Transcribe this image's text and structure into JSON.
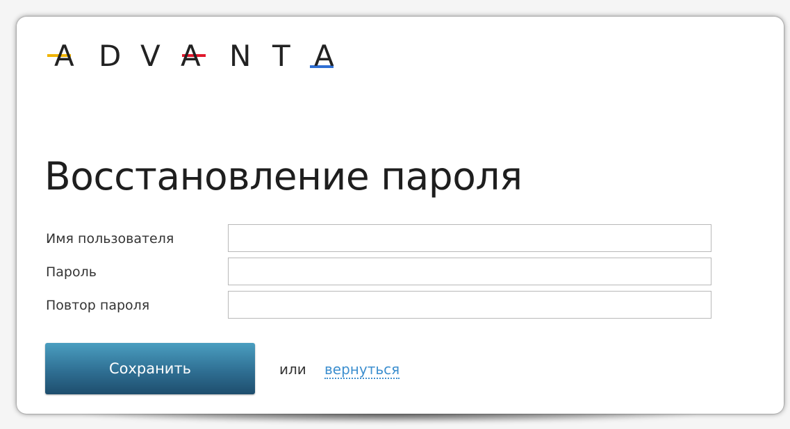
{
  "brand": {
    "logo_letters": [
      "A",
      "D",
      "V",
      "A",
      "N",
      "T",
      "A"
    ],
    "accent_colors": {
      "first_a": "#f0b400",
      "second_a": "#e0182c",
      "third_a": "#2f6fd4"
    }
  },
  "page": {
    "title": "Восстановление пароля"
  },
  "form": {
    "username_label": "Имя пользователя",
    "username_value": "",
    "password_label": "Пароль",
    "password_value": "",
    "repeat_password_label": "Повтор пароля",
    "repeat_password_value": ""
  },
  "actions": {
    "save_label": "Сохранить",
    "or_label": "или",
    "back_label": "вернуться"
  },
  "colors": {
    "button_top": "#4a9ec0",
    "button_bottom": "#1e4e6d",
    "link": "#3d8fcf"
  }
}
